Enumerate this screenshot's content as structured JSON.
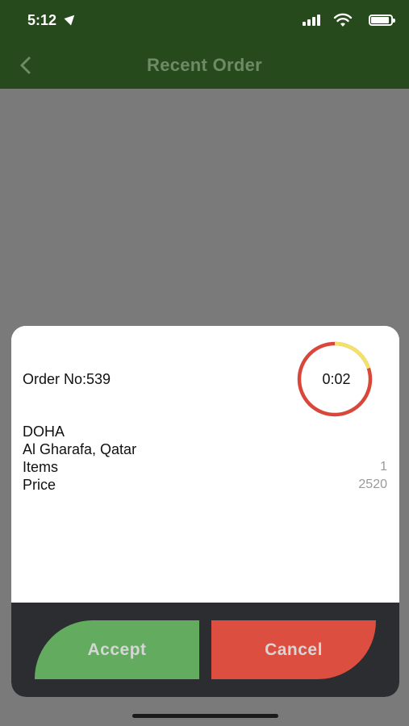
{
  "status_bar": {
    "time": "5:12"
  },
  "nav": {
    "title": "Recent Order",
    "back_icon": "chevron-left-icon"
  },
  "order": {
    "order_no": "Order No:539",
    "timer": {
      "text": "0:02",
      "elapsed_fraction": 0.2
    },
    "city": "DOHA",
    "address": "Al Gharafa, Qatar",
    "items_label": "Items",
    "items_value": "1",
    "price_label": "Price",
    "price_value": "2520"
  },
  "actions": {
    "accept_label": "Accept",
    "cancel_label": "Cancel"
  },
  "colors": {
    "header": "#264a1b",
    "accept": "#63ac5f",
    "cancel": "#dc4f40",
    "timer_track": "#d9473a",
    "timer_progress": "#f1e26a"
  }
}
